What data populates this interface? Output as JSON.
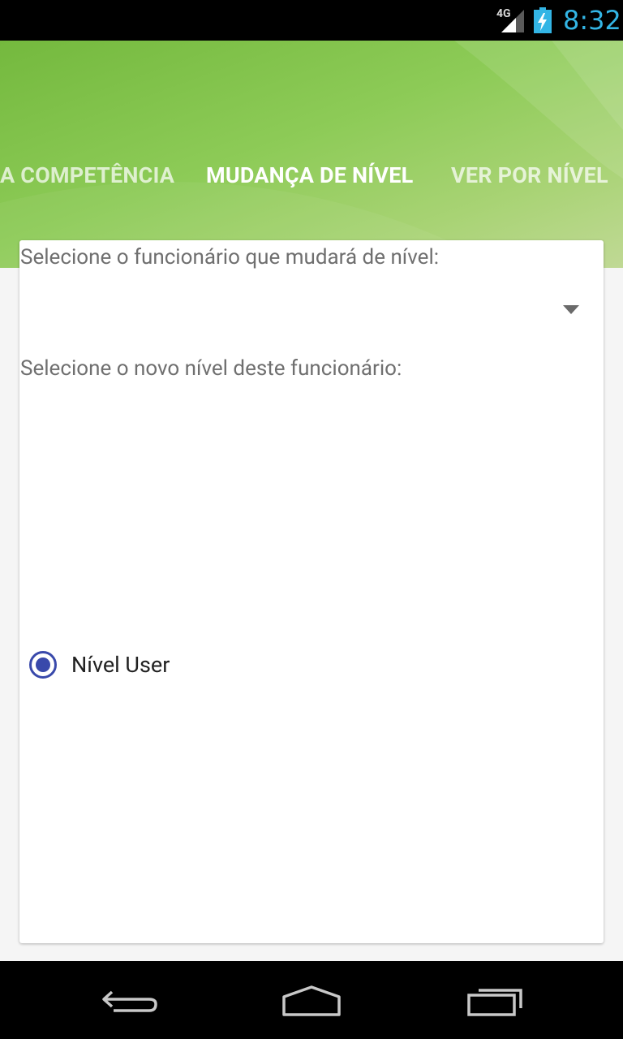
{
  "status_bar": {
    "network": "4G",
    "time": "8:32",
    "time_color": "#33b5e5"
  },
  "header": {
    "tabs": [
      {
        "label": "A COMPETÊNCIA",
        "active": false
      },
      {
        "label": "MUDANÇA DE NÍVEL",
        "active": true
      },
      {
        "label": "VER POR NÍVEL",
        "active": false
      }
    ],
    "gradient_colors": [
      "#74b93e",
      "#c0d995"
    ]
  },
  "form": {
    "employee_prompt": "Selecione o funcionário que mudará de nível:",
    "employee_selected": "",
    "level_prompt": "Selecione o novo nível deste funcionário:",
    "level_options": [
      {
        "label": "Nível User",
        "checked": true
      }
    ],
    "accent_color": "#3949ab"
  },
  "nav_bar": {
    "icons": [
      "back-icon",
      "home-icon",
      "recents-icon"
    ]
  }
}
